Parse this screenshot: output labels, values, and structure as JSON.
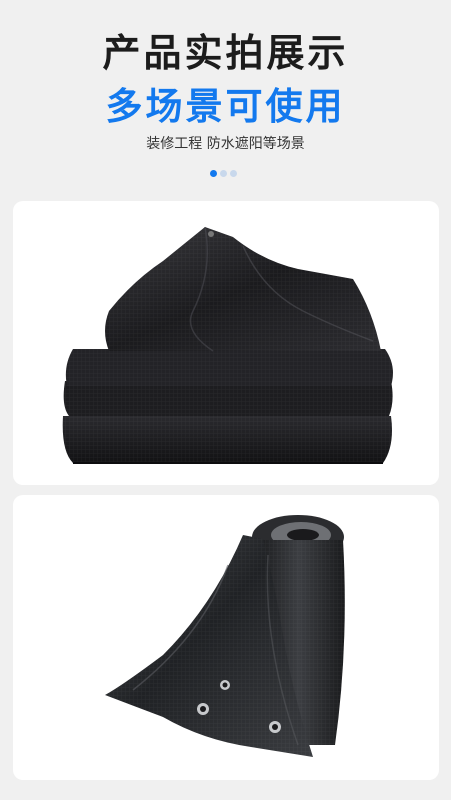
{
  "header": {
    "title": "产品实拍展示",
    "subtitle": "多场景可使用",
    "caption": "装修工程 防水遮阳等场景"
  },
  "carousel": {
    "total": 3,
    "active": 0
  },
  "colors": {
    "accent": "#1379ee",
    "background": "#f0f0f0",
    "tarp": "#1f1f22"
  },
  "photos": [
    {
      "name": "folded-black-tarpaulin"
    },
    {
      "name": "rolled-black-tarpaulin-with-grommets"
    }
  ]
}
